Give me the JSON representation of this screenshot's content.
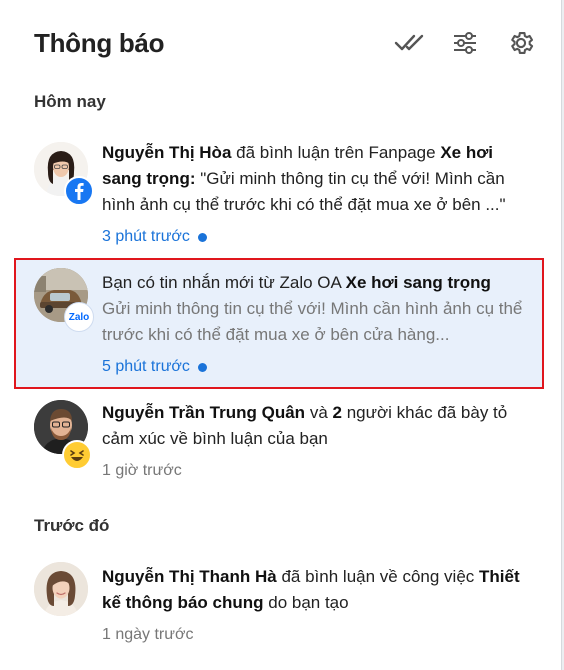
{
  "header": {
    "title": "Thông báo",
    "actions": [
      "mark-all-read-icon",
      "filter-sliders-icon",
      "settings-gear-icon"
    ]
  },
  "sections": {
    "today": "Hôm nay",
    "earlier": "Trước đó"
  },
  "notifications": [
    {
      "actor": "Nguyễn Thị Hòa",
      "action": "đã bình luận trên Fanpage",
      "target": "Xe hơi sang trọng:",
      "quote": "\"Gửi minh thông tin cụ thể với! Mình cần hình ảnh cụ thể trước khi có thể đặt mua xe ở bên ...\"",
      "time": "3 phút trước",
      "unread": true,
      "badge": "facebook-icon"
    },
    {
      "lead": "Bạn có tin nhắn mới từ Zalo OA",
      "target": "Xe hơi sang trọng",
      "preview": "Gửi minh thông tin cụ thể với! Mình cần hình ảnh cụ thể trước khi có thể đặt mua xe ở bên cửa hàng...",
      "time": "5 phút trước",
      "unread": true,
      "badge": "Zalo"
    },
    {
      "actor": "Nguyễn Trần Trung Quân",
      "and": "và",
      "count": "2",
      "action": "người khác đã bày tỏ cảm xúc về bình luận của bạn",
      "time": "1 giờ trước",
      "unread": false,
      "badge": "laugh-emoji-icon"
    },
    {
      "actor": "Nguyễn Thị Thanh Hà",
      "action": "đã bình luận về công việc",
      "target": "Thiết kế thông báo chung",
      "action_end": "do bạn tạo",
      "time": "1 ngày trước",
      "unread": false
    }
  ],
  "colors": {
    "accent": "#1a73d9",
    "highlight_bg": "#e8f0fb",
    "highlight_border": "#e0161d",
    "facebook": "#1877f2",
    "zalo": "#0068ff"
  }
}
